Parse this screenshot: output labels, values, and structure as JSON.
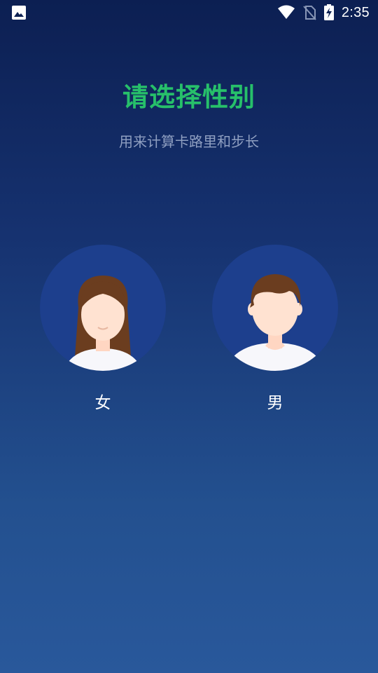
{
  "status_bar": {
    "time": "2:35",
    "icons": [
      "image-icon",
      "wifi-icon",
      "no-sim-icon",
      "battery-charging-icon"
    ]
  },
  "page": {
    "title": "请选择性别",
    "subtitle": "用来计算卡路里和步长"
  },
  "options": [
    {
      "label": "女",
      "icon": "female-avatar-icon"
    },
    {
      "label": "男",
      "icon": "male-avatar-icon"
    }
  ],
  "colors": {
    "title": "#27c06a",
    "subtitle": "#8f9fc1",
    "avatar_bg": "#1d3f8d",
    "background_top": "#0c1f52",
    "background_bottom": "#29589b",
    "hair": "#6b3d1f",
    "skin": "#ffe2d1",
    "shirt": "#f7f7fb"
  }
}
